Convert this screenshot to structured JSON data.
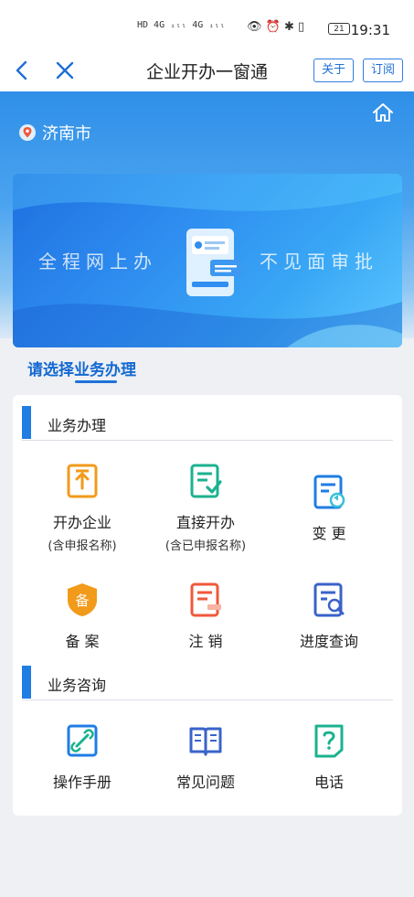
{
  "status_bar": {
    "signal": "HD 4G ᵢₗₗ 4G ᵢₗₗ",
    "battery": "21",
    "time": "19:31"
  },
  "nav": {
    "title": "企业开办一窗通",
    "about_label": "关于",
    "subscribe_label": "订阅"
  },
  "location": {
    "city": "济南市"
  },
  "banner": {
    "left_text": "全程网上办",
    "right_text": "不见面审批"
  },
  "section_title": "请选择业务办理",
  "business": {
    "heading": "业务办理",
    "items": [
      {
        "label": "开办企业",
        "sub": "(含申报名称)"
      },
      {
        "label": "直接开办",
        "sub": "(含已申报名称)"
      },
      {
        "label": "变 更",
        "sub": ""
      },
      {
        "label": "备 案",
        "sub": ""
      },
      {
        "label": "注 销",
        "sub": ""
      },
      {
        "label": "进度查询",
        "sub": ""
      }
    ]
  },
  "consult": {
    "heading": "业务咨询",
    "items": [
      {
        "label": "操作手册"
      },
      {
        "label": "常见问题"
      },
      {
        "label": "电话"
      }
    ]
  },
  "colors": {
    "accent": "#1f7de3",
    "orange": "#f29a1a",
    "green": "#1bb28f",
    "red": "#f0583b"
  }
}
